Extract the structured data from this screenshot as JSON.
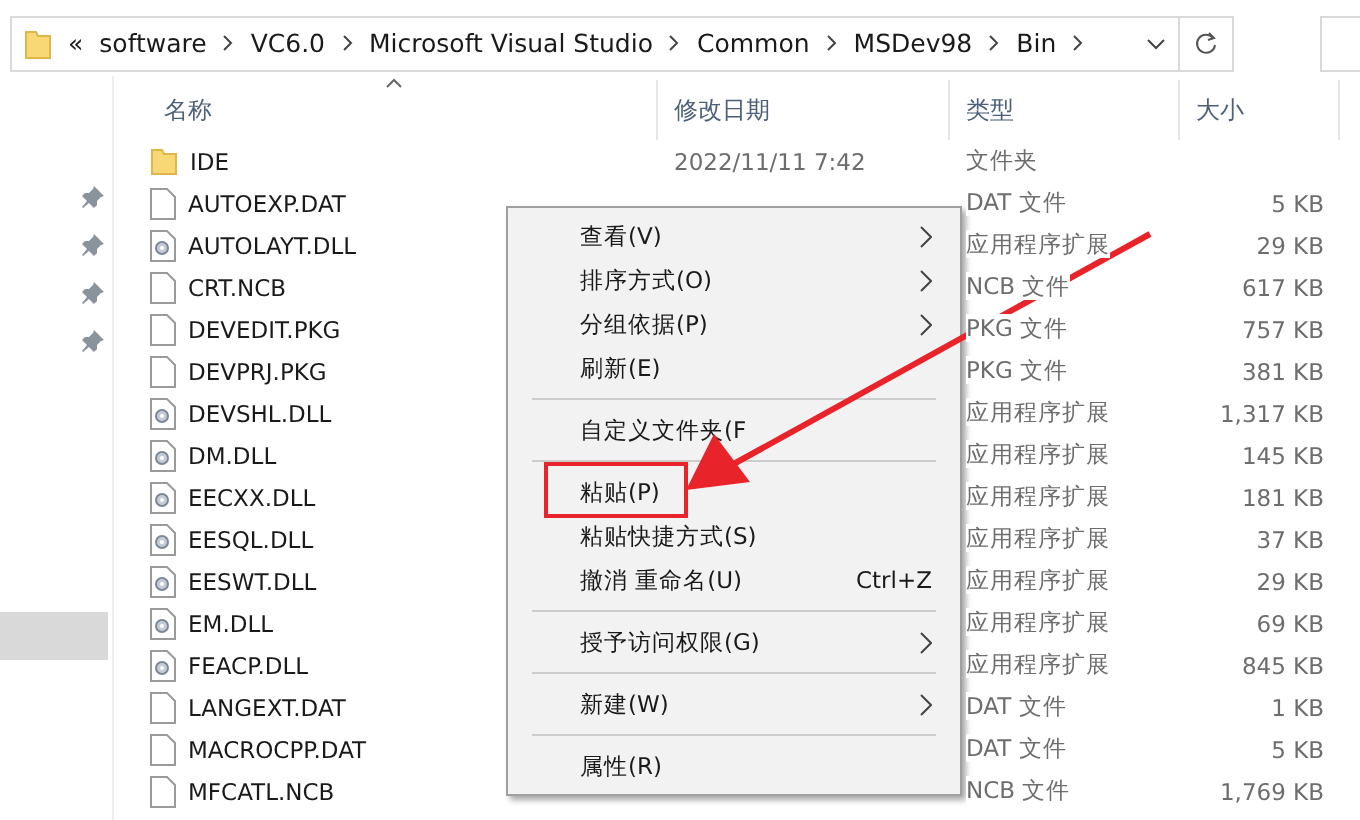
{
  "address_bar": {
    "overflow": "«",
    "crumbs": [
      "software",
      "VC6.0",
      "Microsoft Visual Studio",
      "Common",
      "MSDev98",
      "Bin"
    ]
  },
  "sidebar": {
    "selected_row": true
  },
  "columns": [
    {
      "label": "名称",
      "sorted": true
    },
    {
      "label": "修改日期",
      "sorted": false
    },
    {
      "label": "类型",
      "sorted": false
    },
    {
      "label": "大小",
      "sorted": false
    }
  ],
  "files": [
    {
      "kind": "folder",
      "name": "IDE",
      "date": "2022/11/11 7:42",
      "type": "文件夹"
    },
    {
      "kind": "file",
      "name": "AUTOEXP.DAT",
      "type": "DAT 文件",
      "size": "5 KB"
    },
    {
      "kind": "dll",
      "name": "AUTOLAYT.DLL",
      "type": "应用程序扩展",
      "size": "29 KB"
    },
    {
      "kind": "file",
      "name": "CRT.NCB",
      "type": "NCB 文件",
      "size": "617 KB"
    },
    {
      "kind": "file",
      "name": "DEVEDIT.PKG",
      "type": "PKG 文件",
      "size": "757 KB"
    },
    {
      "kind": "file",
      "name": "DEVPRJ.PKG",
      "type": "PKG 文件",
      "size": "381 KB"
    },
    {
      "kind": "dll",
      "name": "DEVSHL.DLL",
      "type": "应用程序扩展",
      "size": "1,317 KB"
    },
    {
      "kind": "dll",
      "name": "DM.DLL",
      "type": "应用程序扩展",
      "size": "145 KB"
    },
    {
      "kind": "dll",
      "name": "EECXX.DLL",
      "type": "应用程序扩展",
      "size": "181 KB"
    },
    {
      "kind": "dll",
      "name": "EESQL.DLL",
      "type": "应用程序扩展",
      "size": "37 KB"
    },
    {
      "kind": "dll",
      "name": "EESWT.DLL",
      "type": "应用程序扩展",
      "size": "29 KB"
    },
    {
      "kind": "dll",
      "name": "EM.DLL",
      "type": "应用程序扩展",
      "size": "69 KB"
    },
    {
      "kind": "dll",
      "name": "FEACP.DLL",
      "type": "应用程序扩展",
      "size": "845 KB"
    },
    {
      "kind": "file",
      "name": "LANGEXT.DAT",
      "type": "DAT 文件",
      "size": "1 KB"
    },
    {
      "kind": "file",
      "name": "MACROCPP.DAT",
      "type": "DAT 文件",
      "size": "5 KB"
    },
    {
      "kind": "file",
      "name": "MFCATL.NCB",
      "type": "NCB 文件",
      "size": "1,769 KB"
    }
  ],
  "context_menu": [
    {
      "kind": "item",
      "label": "查看(V)",
      "submenu": true,
      "boxed": false
    },
    {
      "kind": "item",
      "label": "排序方式(O)",
      "submenu": true,
      "boxed": false
    },
    {
      "kind": "item",
      "label": "分组依据(P)",
      "submenu": true,
      "boxed": false
    },
    {
      "kind": "item",
      "label": "刷新(E)",
      "submenu": false,
      "boxed": false
    },
    {
      "kind": "separator"
    },
    {
      "kind": "item",
      "label": "自定义文件夹(F",
      "submenu": false,
      "boxed": false
    },
    {
      "kind": "separator"
    },
    {
      "kind": "item",
      "label": "粘贴(P)",
      "submenu": false,
      "boxed": true
    },
    {
      "kind": "item",
      "label": "粘贴快捷方式(S)",
      "submenu": false,
      "boxed": false
    },
    {
      "kind": "item",
      "label": "撤消 重命名(U)",
      "shortcut": "Ctrl+Z",
      "submenu": false,
      "boxed": false
    },
    {
      "kind": "separator"
    },
    {
      "kind": "item",
      "label": "授予访问权限(G)",
      "submenu": true,
      "boxed": false
    },
    {
      "kind": "separator"
    },
    {
      "kind": "item",
      "label": "新建(W)",
      "submenu": true,
      "boxed": false
    },
    {
      "kind": "separator"
    },
    {
      "kind": "item",
      "label": "属性(R)",
      "submenu": false,
      "boxed": false
    }
  ]
}
